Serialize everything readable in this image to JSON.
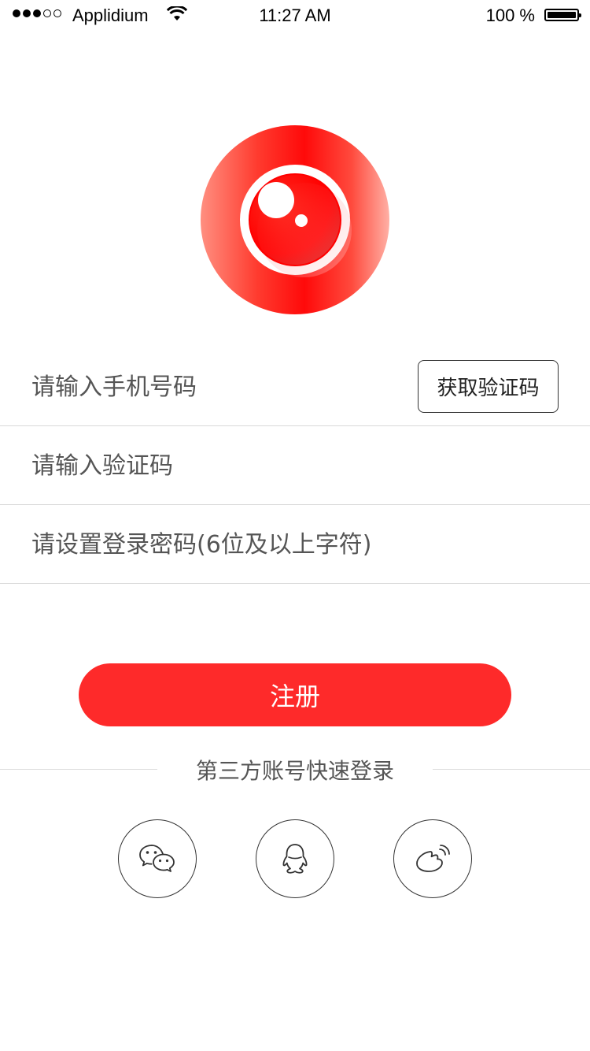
{
  "status_bar": {
    "carrier": "Applidium",
    "time": "11:27 AM",
    "battery": "100 %"
  },
  "colors": {
    "brand_red": "#fe2a2a",
    "text_dark": "#333333",
    "divider": "#d9d9d9"
  },
  "form": {
    "phone_placeholder": "请输入手机号码",
    "get_code_label": "获取验证码",
    "code_placeholder": "请输入验证码",
    "password_placeholder": "请设置登录密码(6位及以上字符)"
  },
  "register_label": "注册",
  "third_party": {
    "title": "第三方账号快速登录",
    "providers": [
      {
        "icon": "wechat-icon"
      },
      {
        "icon": "qq-icon"
      },
      {
        "icon": "weibo-icon"
      }
    ]
  }
}
